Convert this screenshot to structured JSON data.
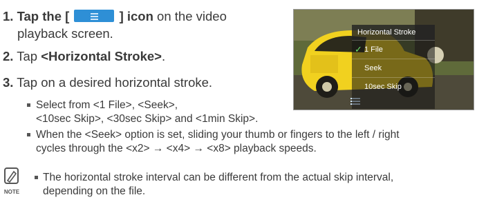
{
  "steps": [
    {
      "num": "1.",
      "pre": "Tap the [",
      "post": "] icon",
      "tail": " on the video",
      "line2": "playback screen."
    },
    {
      "num": "2.",
      "text": "Tap ",
      "bold": "<Horizontal Stroke>",
      "end": "."
    },
    {
      "num": "3.",
      "text": "Tap on a desired horizontal stroke."
    }
  ],
  "bullets": [
    {
      "line1": "Select from <1 File>, <Seek>,",
      "line2": "<10sec Skip>, <30sec Skip> and <1min Skip>."
    },
    {
      "line1": "When the <Seek> option is set, sliding your thumb or fingers to the left / right",
      "line2": "cycles through the <x2> → <x4> → <x8> playback speeds."
    }
  ],
  "screen_menu": {
    "header": "Horizontal Stroke",
    "items": [
      {
        "label": "1 File",
        "checked": true
      },
      {
        "label": "Seek",
        "checked": false
      },
      {
        "label": "10sec Skip",
        "checked": false
      }
    ]
  },
  "note": {
    "icon_label": "NOTE",
    "line1": "The horizontal stroke interval can be different from the actual skip interval,",
    "line2": "depending on the file."
  },
  "colors": {
    "accent": "#2e8fd6",
    "text": "#3a3a3a"
  }
}
